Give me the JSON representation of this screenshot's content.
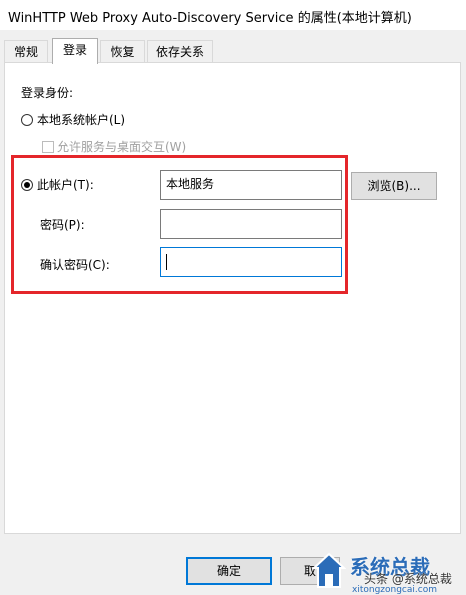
{
  "window": {
    "title": "WinHTTP Web Proxy Auto-Discovery Service 的属性(本地计算机)"
  },
  "tabs": [
    {
      "label": "常规"
    },
    {
      "label": "登录"
    },
    {
      "label": "恢复"
    },
    {
      "label": "依存关系"
    }
  ],
  "login": {
    "section_label": "登录身份:",
    "local_system_label": "本地系统帐户(L)",
    "interact_label": "允许服务与桌面交互(W)",
    "this_account_label": "此帐户(T):",
    "account_value": "本地服务",
    "browse_label": "浏览(B)...",
    "password_label": "密码(P):",
    "confirm_label": "确认密码(C):"
  },
  "footer": {
    "ok_label": "确定",
    "cancel_label": "取"
  },
  "watermark": {
    "brand": "系统总裁",
    "domain": "xitongzongcai.com",
    "handle": "头条 @系统总裁"
  },
  "colors": {
    "highlight": "#e4262a",
    "focus": "#0078d7"
  }
}
